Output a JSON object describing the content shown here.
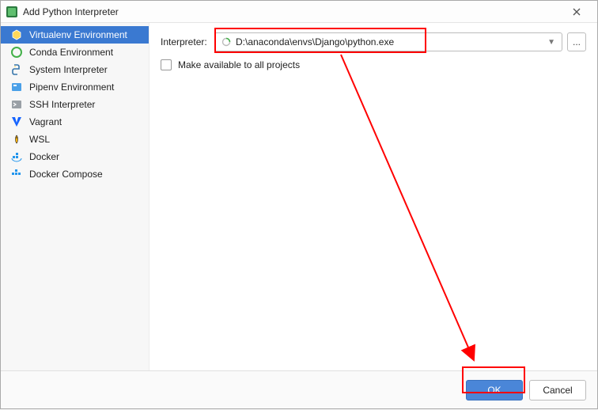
{
  "titlebar": {
    "title": "Add Python Interpreter"
  },
  "sidebar": {
    "items": [
      {
        "label": "Virtualenv Environment",
        "icon": "virtualenv-icon",
        "selected": true
      },
      {
        "label": "Conda Environment",
        "icon": "conda-icon",
        "selected": false
      },
      {
        "label": "System Interpreter",
        "icon": "python-icon",
        "selected": false
      },
      {
        "label": "Pipenv Environment",
        "icon": "pipenv-icon",
        "selected": false
      },
      {
        "label": "SSH Interpreter",
        "icon": "ssh-icon",
        "selected": false
      },
      {
        "label": "Vagrant",
        "icon": "vagrant-icon",
        "selected": false
      },
      {
        "label": "WSL",
        "icon": "wsl-icon",
        "selected": false
      },
      {
        "label": "Docker",
        "icon": "docker-icon",
        "selected": false
      },
      {
        "label": "Docker Compose",
        "icon": "docker-compose-icon",
        "selected": false
      }
    ]
  },
  "main": {
    "interpreter_label": "Interpreter:",
    "interpreter_value": "D:\\anaconda\\envs\\Django\\python.exe",
    "browse_label": "...",
    "checkbox_label": "Make available to all projects",
    "checkbox_checked": false
  },
  "footer": {
    "ok_label": "OK",
    "cancel_label": "Cancel"
  }
}
